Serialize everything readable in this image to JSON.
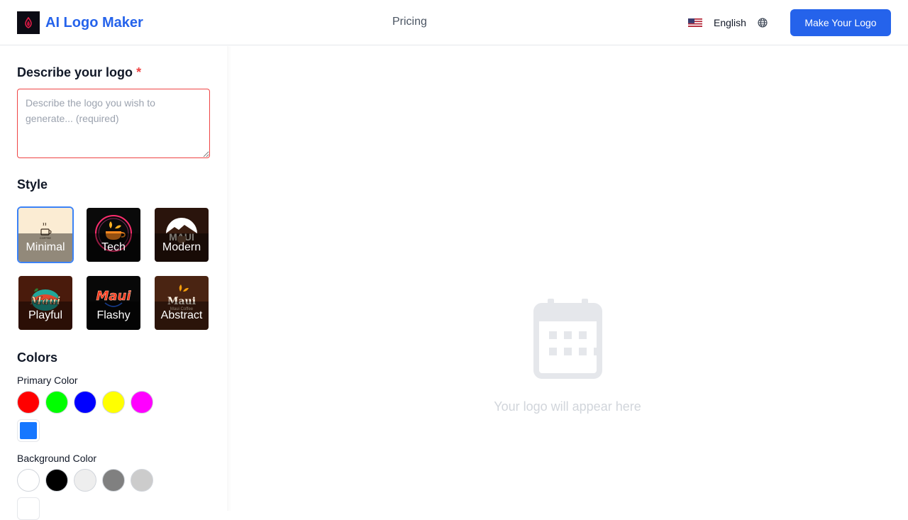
{
  "header": {
    "brand": "AI Logo Maker",
    "pricing": "Pricing",
    "language": "English",
    "cta": "Make Your Logo"
  },
  "sidebar": {
    "describe": {
      "title": "Describe your logo",
      "required_mark": "*",
      "placeholder": "Describe the logo you wish to generate... (required)",
      "value": ""
    },
    "style": {
      "title": "Style",
      "selected": "Minimal",
      "options": [
        {
          "label": "Minimal",
          "art_text": "COFFEE"
        },
        {
          "label": "Tech"
        },
        {
          "label": "Modern",
          "art_text": "MAUI"
        },
        {
          "label": "Playful",
          "art_text": "Maui"
        },
        {
          "label": "Flashy",
          "art_text": "Maui"
        },
        {
          "label": "Abstract",
          "art_text": "Maui",
          "art_subtext": "Maui Coffee"
        }
      ]
    },
    "colors": {
      "title": "Colors",
      "primary_label": "Primary Color",
      "primary_swatches": [
        "#ff0000",
        "#00ff00",
        "#0000ff",
        "#ffff00",
        "#ff00ff"
      ],
      "primary_custom": "#1677ff",
      "background_label": "Background Color",
      "background_swatches": [
        "#ffffff",
        "#000000",
        "#eeeeee",
        "#808080",
        "#cccccc"
      ],
      "background_custom": "#ffffff"
    }
  },
  "main": {
    "placeholder_text": "Your logo will appear here",
    "placeholder_icon": "calendar-icon"
  },
  "colors": {
    "accent": "#2563eb",
    "required": "#ef4444",
    "placeholder_gray": "#d1d5db",
    "selected_border": "#3b82f6"
  }
}
